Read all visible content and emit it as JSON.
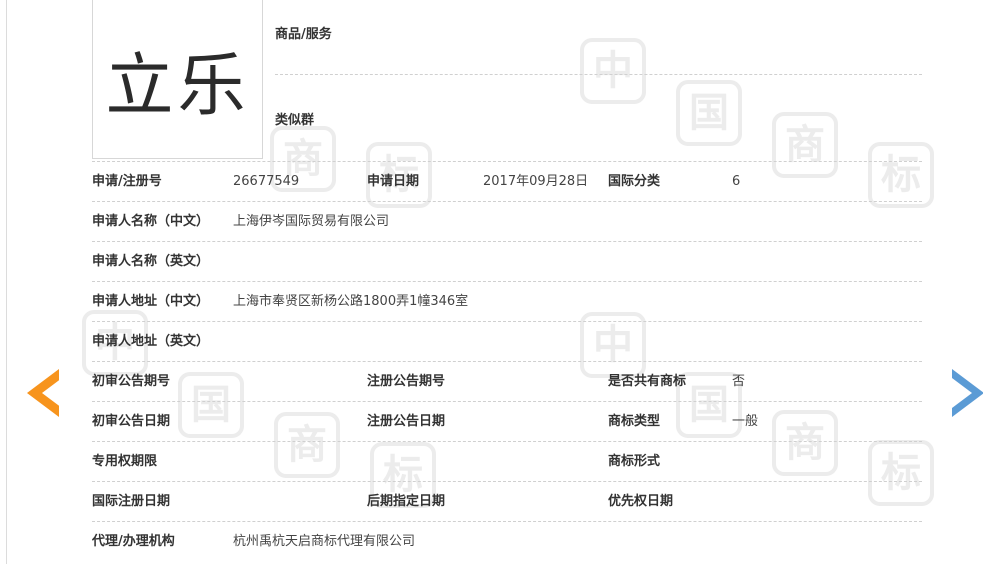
{
  "trademark": {
    "name": "立乐"
  },
  "goods_label": "商品/服务",
  "similar_label": "类似群",
  "watermark_chars": [
    "中",
    "国",
    "商",
    "标"
  ],
  "rows": [
    {
      "cells": [
        {
          "label": "申请/注册号",
          "value": "26677549"
        },
        {
          "label": "申请日期",
          "value": "2017年09月28日"
        },
        {
          "label": "国际分类",
          "value": "6"
        }
      ]
    },
    {
      "cells": [
        {
          "label": "申请人名称（中文）",
          "value": "上海伊岑国际贸易有限公司"
        }
      ]
    },
    {
      "cells": [
        {
          "label": "申请人名称（英文）",
          "value": ""
        }
      ]
    },
    {
      "cells": [
        {
          "label": "申请人地址（中文）",
          "value": "上海市奉贤区新杨公路1800弄1幢346室"
        }
      ]
    },
    {
      "cells": [
        {
          "label": "申请人地址（英文）",
          "value": ""
        }
      ]
    },
    {
      "cells": [
        {
          "label": "初审公告期号",
          "value": ""
        },
        {
          "label": "注册公告期号",
          "value": ""
        },
        {
          "label": "是否共有商标",
          "value": "否"
        }
      ]
    },
    {
      "cells": [
        {
          "label": "初审公告日期",
          "value": ""
        },
        {
          "label": "注册公告日期",
          "value": ""
        },
        {
          "label": "商标类型",
          "value": "一般"
        }
      ]
    },
    {
      "cells": [
        {
          "label": "专用权期限",
          "value": ""
        },
        {
          "label": "",
          "value": ""
        },
        {
          "label": "商标形式",
          "value": ""
        }
      ]
    },
    {
      "cells": [
        {
          "label": "国际注册日期",
          "value": ""
        },
        {
          "label": "后期指定日期",
          "value": ""
        },
        {
          "label": "优先权日期",
          "value": ""
        }
      ]
    },
    {
      "cells": [
        {
          "label": "代理/办理机构",
          "value": "杭州禹杭天启商标代理有限公司"
        }
      ]
    }
  ],
  "nav": {
    "prev_icon": "chevron-left-icon",
    "next_icon": "chevron-right-icon",
    "prev_color": "#f7941d",
    "next_color": "#5b9bd5"
  }
}
